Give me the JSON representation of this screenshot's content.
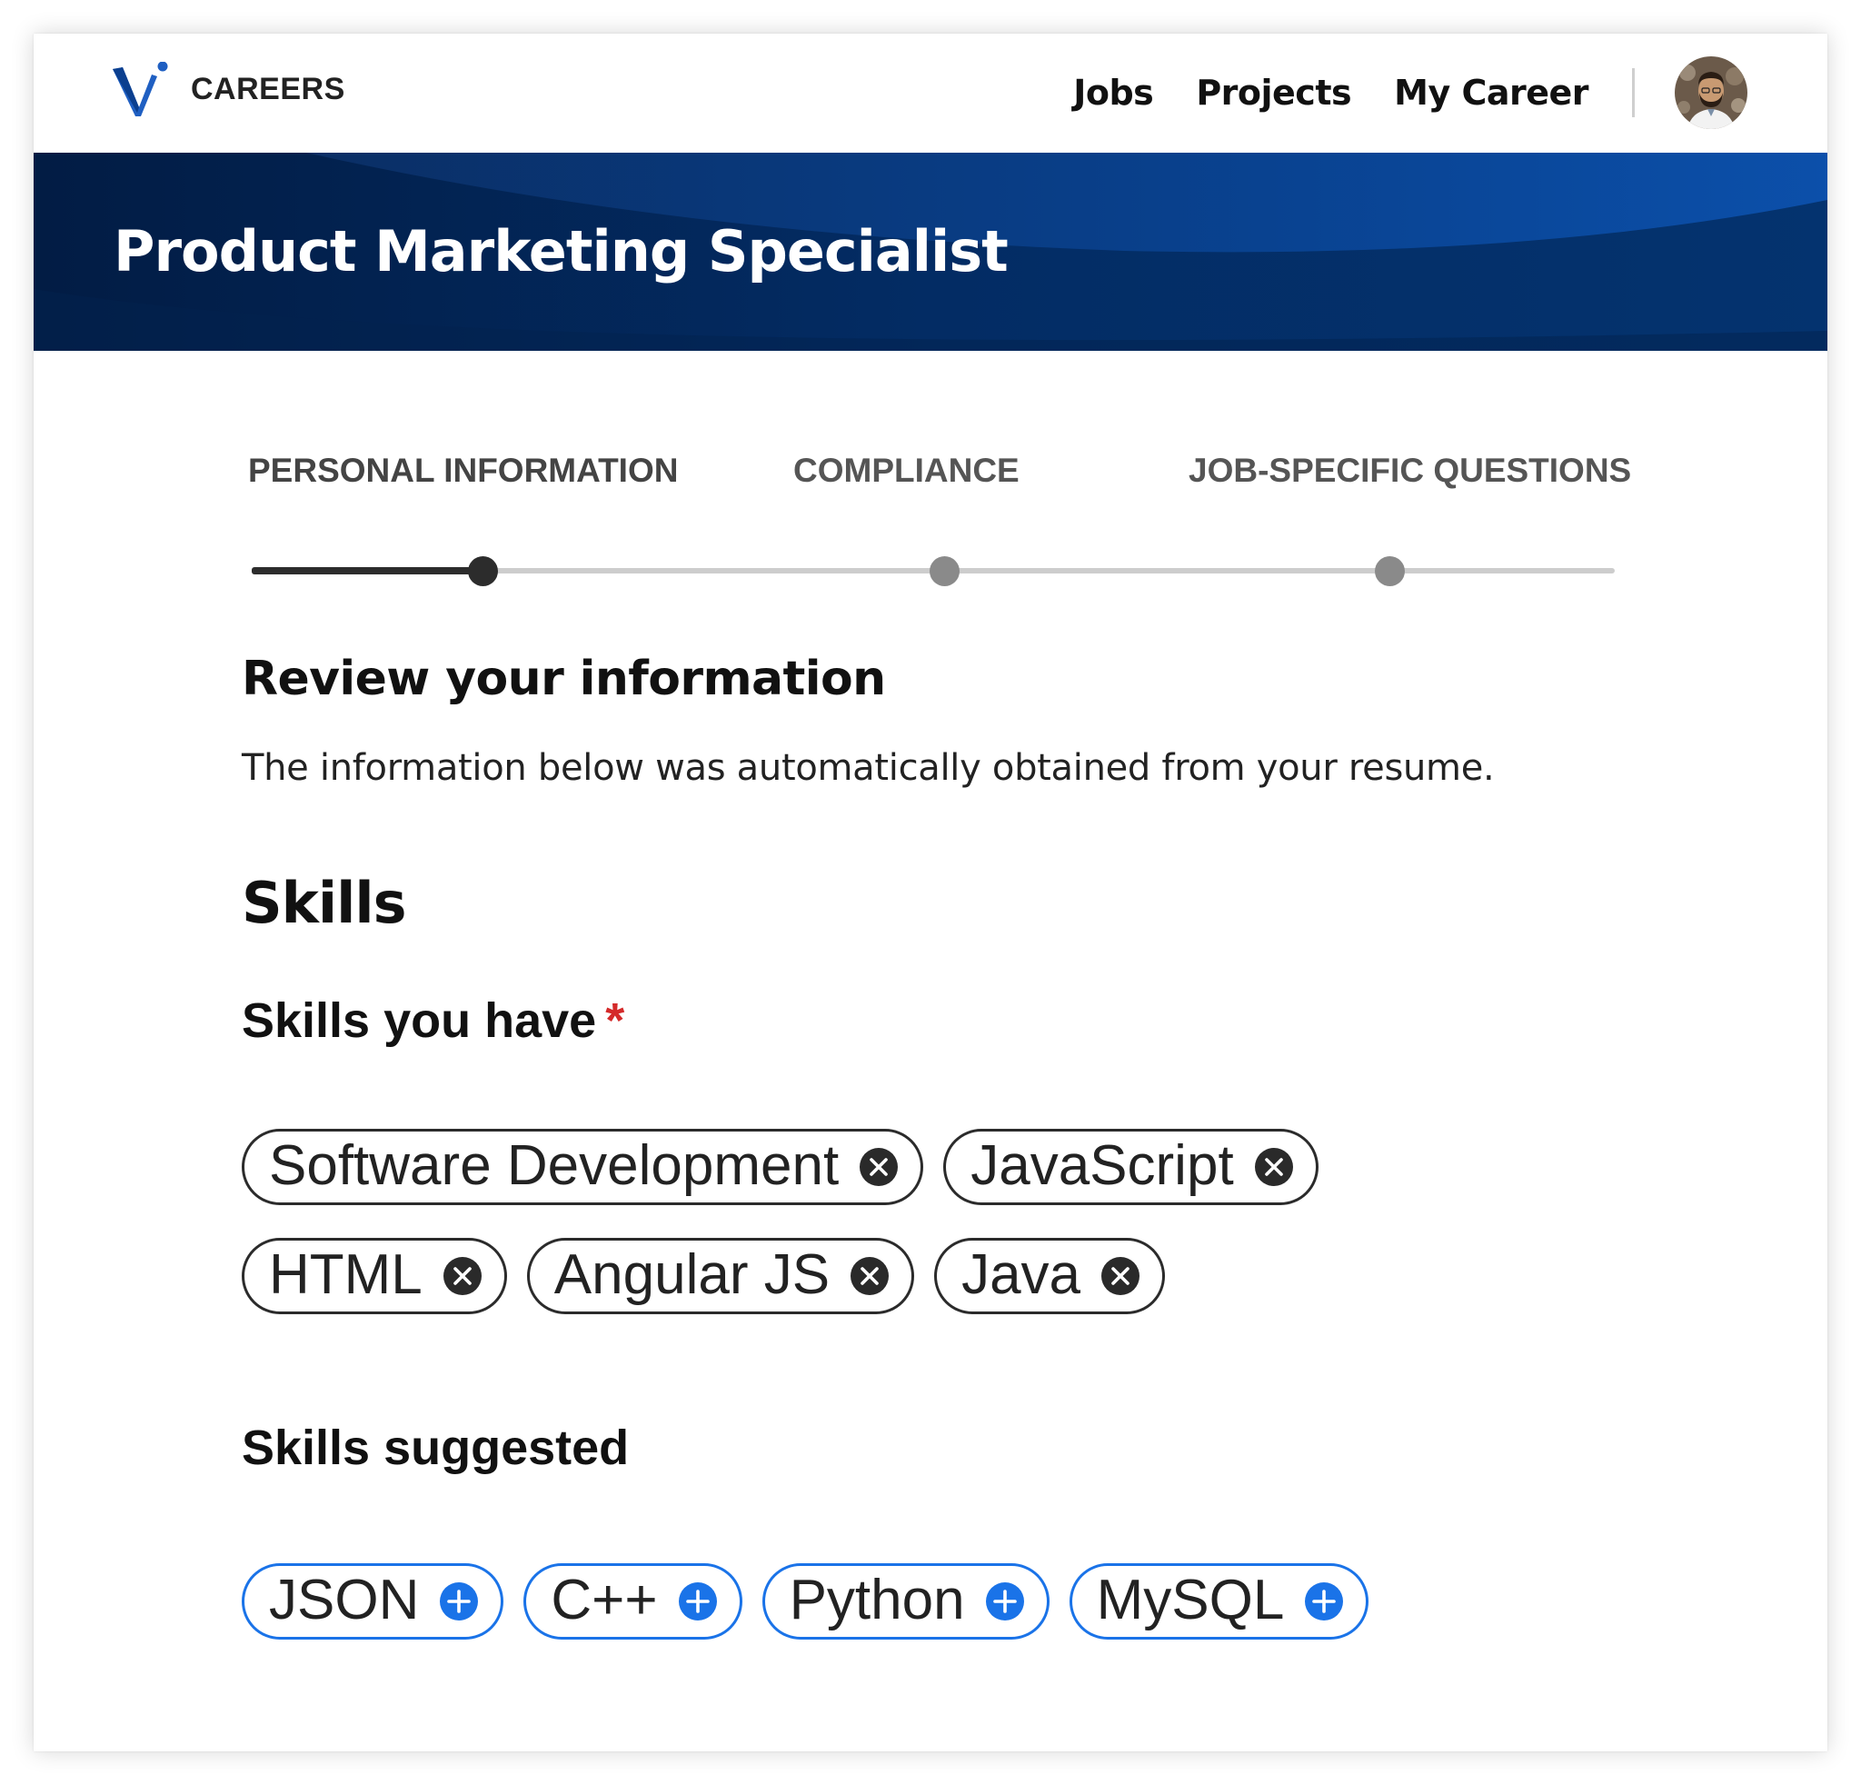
{
  "brand": {
    "name": "CAREERS",
    "accent": "#1565c0"
  },
  "nav": {
    "links": [
      "Jobs",
      "Projects",
      "My Career"
    ]
  },
  "banner": {
    "title": "Product Marketing Specialist",
    "colors": [
      "#02204a",
      "#063a7a",
      "#0a4ea8"
    ]
  },
  "stepper": {
    "steps": [
      "PERSONAL INFORMATION",
      "COMPLIANCE",
      "JOB-SPECIFIC QUESTIONS"
    ],
    "current_step": 1
  },
  "review": {
    "title": "Review your information",
    "description": "The information below was automatically obtained from your resume."
  },
  "skills": {
    "title": "Skills",
    "have_label": "Skills you have",
    "required_mark": "*",
    "have": [
      "Software Development",
      "JavaScript",
      "HTML",
      "Angular JS",
      "Java"
    ],
    "suggested_label": "Skills suggested",
    "suggested": [
      "JSON",
      "C++",
      "Python",
      "MySQL"
    ],
    "remove_icon": "close-circle-icon",
    "add_icon": "plus-circle-icon",
    "suggest_color": "#1a73e8"
  }
}
